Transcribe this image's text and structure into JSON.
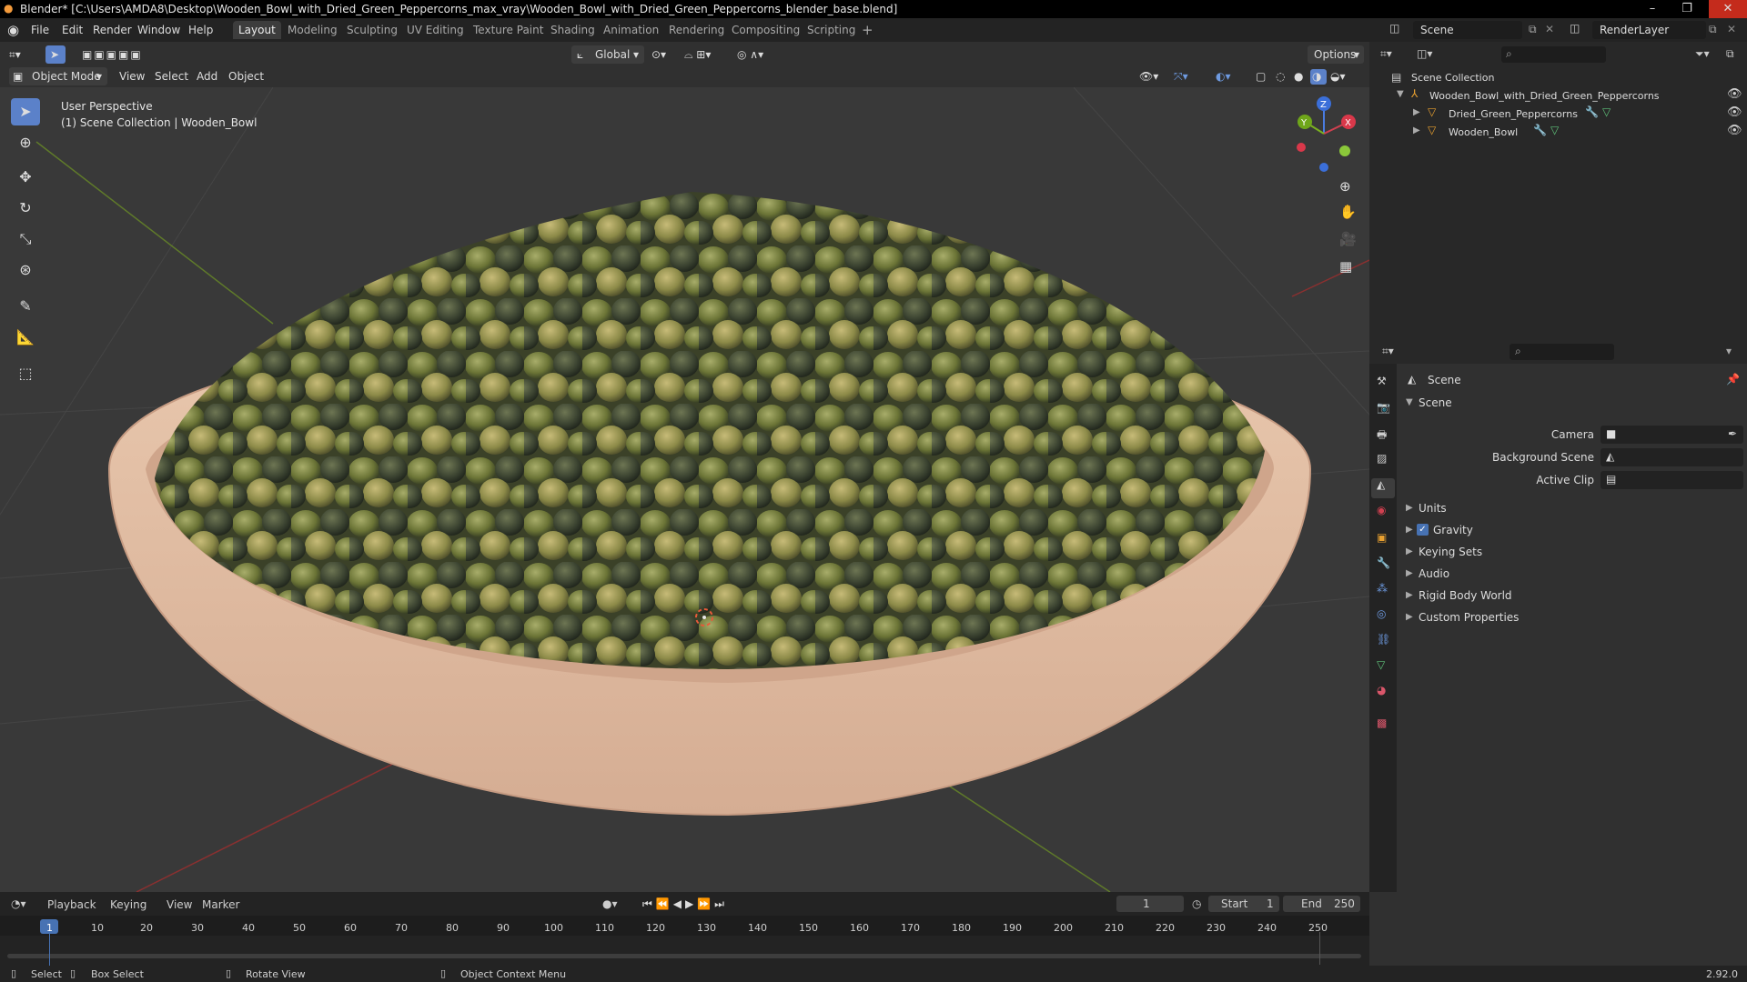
{
  "window": {
    "title": "Blender* [C:\\Users\\AMDA8\\Desktop\\Wooden_Bowl_with_Dried_Green_Peppercorns_max_vray\\Wooden_Bowl_with_Dried_Green_Peppercorns_blender_base.blend]",
    "minimize": "–",
    "maximize": "❐",
    "close": "✕"
  },
  "menubar": {
    "items": [
      "File",
      "Edit",
      "Render",
      "Window",
      "Help"
    ],
    "workspaces": [
      "Layout",
      "Modeling",
      "Sculpting",
      "UV Editing",
      "Texture Paint",
      "Shading",
      "Animation",
      "Rendering",
      "Compositing",
      "Scripting"
    ],
    "add_workspace": "+",
    "scene_label": "Scene",
    "render_layer": "RenderLayer"
  },
  "viewport_header": {
    "transform_orientation": "Global",
    "options": "Options",
    "mode": "Object Mode",
    "menus": [
      "View",
      "Select",
      "Add",
      "Object"
    ]
  },
  "viewport": {
    "perspective": "User Perspective",
    "collection_path": "(1) Scene Collection | Wooden_Bowl",
    "gizmo_axes": {
      "z": "Z",
      "y": "Y",
      "x": "X"
    }
  },
  "outliner": {
    "root": "Scene Collection",
    "items": [
      {
        "label": "Wooden_Bowl_with_Dried_Green_Peppercorns"
      },
      {
        "label": "Dried_Green_Peppercorns"
      },
      {
        "label": "Wooden_Bowl"
      }
    ]
  },
  "properties": {
    "header": "Scene",
    "panel_title": "Scene",
    "fields": [
      {
        "label": "Camera",
        "value": ""
      },
      {
        "label": "Background Scene",
        "value": ""
      },
      {
        "label": "Active Clip",
        "value": ""
      }
    ],
    "sections": [
      "Units",
      "Gravity",
      "Keying Sets",
      "Audio",
      "Rigid Body World",
      "Custom Properties"
    ],
    "gravity_checked": true
  },
  "timeline": {
    "menus": [
      "Playback",
      "Keying",
      "View",
      "Marker"
    ],
    "current_frame": "1",
    "start_label": "Start",
    "start": "1",
    "end_label": "End",
    "end": "250",
    "ruler": [
      "1",
      "10",
      "20",
      "30",
      "40",
      "50",
      "60",
      "70",
      "80",
      "90",
      "100",
      "110",
      "120",
      "130",
      "140",
      "150",
      "160",
      "170",
      "180",
      "190",
      "200",
      "210",
      "220",
      "230",
      "240",
      "250"
    ]
  },
  "statusbar": {
    "select": "Select",
    "box_select": "Box Select",
    "rotate": "Rotate View",
    "context": "Object Context Menu",
    "version": "2.92.0"
  },
  "colors": {
    "accent": "#4772b3",
    "viewport_bg": "#393939",
    "bowl": "#e2bfa4",
    "peppercorn": "#6e7a3a"
  }
}
